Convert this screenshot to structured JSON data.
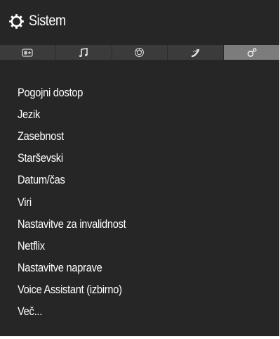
{
  "header": {
    "icon": "gear-icon",
    "title": "Sistem"
  },
  "tabs": [
    {
      "icon": "picture-icon",
      "active": false
    },
    {
      "icon": "music-note-icon",
      "active": false
    },
    {
      "icon": "network-globe-icon",
      "active": false
    },
    {
      "icon": "satellite-dish-icon",
      "active": false
    },
    {
      "icon": "system-settings-icon",
      "active": true
    }
  ],
  "menu": {
    "items": [
      {
        "label": "Pogojni dostop"
      },
      {
        "label": "Jezik"
      },
      {
        "label": "Zasebnost"
      },
      {
        "label": "Starševski"
      },
      {
        "label": "Datum/čas"
      },
      {
        "label": "Viri"
      },
      {
        "label": "Nastavitve za invalidnost"
      },
      {
        "label": "Netflix"
      },
      {
        "label": "Nastavitve naprave"
      },
      {
        "label": "Voice Assistant (izbirno)"
      },
      {
        "label": "Več..."
      }
    ]
  },
  "colors": {
    "panel_bg": "#262626",
    "tab_bg": "#3b3b3b",
    "tab_active_bg": "#7c7c7c",
    "text": "#ffffff"
  }
}
